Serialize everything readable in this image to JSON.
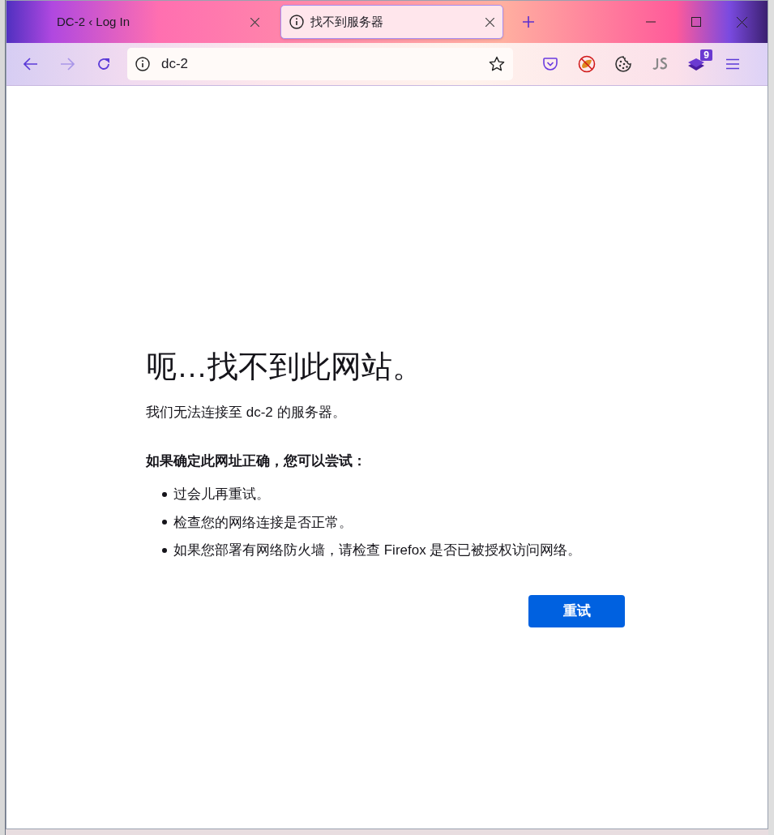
{
  "tabs": [
    {
      "title": "DC-2 ‹ Log In",
      "selected": false,
      "icon": false
    },
    {
      "title": "找不到服务器",
      "selected": true,
      "icon": true
    }
  ],
  "address_bar": {
    "value": "dc-2"
  },
  "extension_badge": "9",
  "error": {
    "heading": "呃…找不到此网站。",
    "message": "我们无法连接至 dc-2 的服务器。",
    "suggestions_title": "如果确定此网址正确，您可以尝试：",
    "suggestions": [
      "过会儿再重试。",
      "检查您的网络连接是否正常。",
      "如果您部署有网络防火墙，请检查 Firefox 是否已被授权访问网络。"
    ],
    "button": "重试"
  }
}
